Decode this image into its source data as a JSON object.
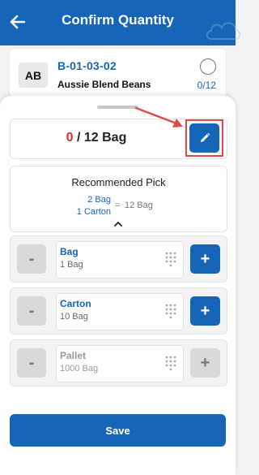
{
  "header": {
    "title": "Confirm Quantity",
    "back_icon": "arrow-left-icon"
  },
  "item": {
    "avatar": "AB",
    "code": "B-01-03-02",
    "name": "Aussie Blend Beans",
    "picked": "0",
    "total": "12",
    "count_text": "0/12"
  },
  "quantity": {
    "current": "0",
    "rest": " / 12 Bag",
    "edit_icon": "pencil-icon"
  },
  "recommended": {
    "title": "Recommended Pick",
    "line1": "2 Bag",
    "line2": "1 Carton",
    "equals": "=",
    "total": "12 Bag",
    "expand_icon": "chevron-up-icon"
  },
  "units": [
    {
      "name": "Bag",
      "sub": "1 Bag",
      "minus": "-",
      "plus": "+",
      "plus_enabled": true
    },
    {
      "name": "Carton",
      "sub": "10 Bag",
      "minus": "-",
      "plus": "+",
      "plus_enabled": true
    },
    {
      "name": "Pallet",
      "sub": "1000 Bag",
      "minus": "-",
      "plus": "+",
      "plus_enabled": false
    }
  ],
  "save_label": "Save",
  "colors": {
    "primary": "#1765b6",
    "alert": "#e02a2a",
    "highlight": "#e14b45"
  }
}
